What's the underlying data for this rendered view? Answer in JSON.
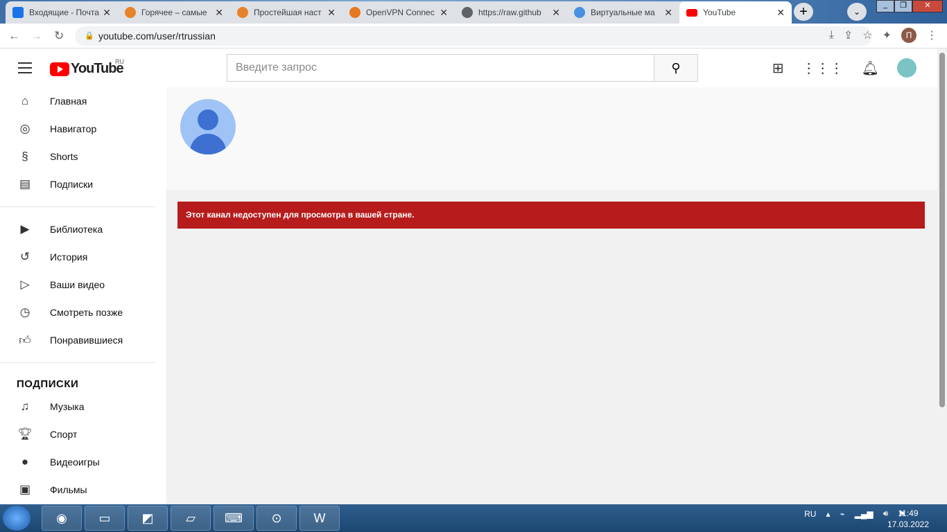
{
  "browser": {
    "tabs": [
      {
        "title": "Входящие - Почта",
        "color": "#1a73e8"
      },
      {
        "title": "Горячее – самые",
        "color": "#e8822a"
      },
      {
        "title": "Простейшая наст",
        "color": "#e8822a"
      },
      {
        "title": "OpenVPN Connec",
        "color": "#e87722"
      },
      {
        "title": "https://raw.github",
        "color": "#5f6368"
      },
      {
        "title": "Виртуальные ма",
        "color": "#4a90e2"
      },
      {
        "title": "YouTube",
        "color": "#ff0000"
      }
    ],
    "url": "youtube.com/user/rtrussian",
    "profile_initial": "П"
  },
  "youtube": {
    "logo_text": "YouTube",
    "country": "RU",
    "search_placeholder": "Введите запрос",
    "nav": [
      "Главная",
      "Навигатор",
      "Shorts",
      "Подписки"
    ],
    "library": [
      "Библиотека",
      "История",
      "Ваши видео",
      "Смотреть позже",
      "Понравившиеся"
    ],
    "subs_heading": "ПОДПИСКИ",
    "subs": [
      "Музыка",
      "Спорт",
      "Видеоигры",
      "Фильмы"
    ],
    "alert": "Этот канал недоступен для просмотра в вашей стране."
  },
  "taskbar": {
    "lang": "RU",
    "time": "11:49",
    "date": "17.03.2022"
  }
}
